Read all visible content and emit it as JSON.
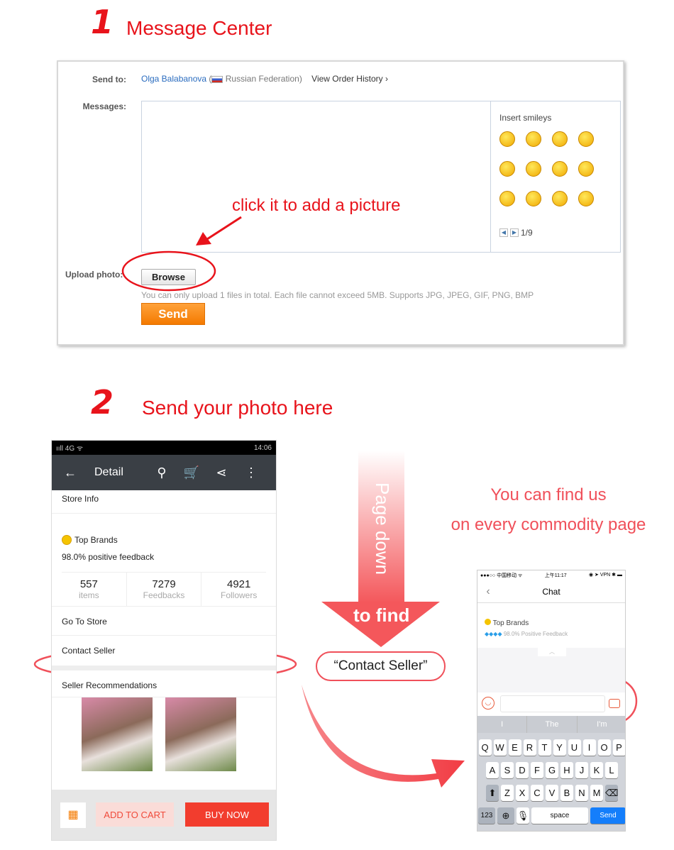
{
  "step1": {
    "number": "1",
    "title": "Message Center"
  },
  "form": {
    "send_to_label": "Send to:",
    "recipient": "Olga Balabanova",
    "country": "Russian Federation)",
    "open_paren": "(",
    "view_history": "View Order History ›",
    "messages_label": "Messages:",
    "insert_smileys": "Insert smileys",
    "smiley_page": "1/9",
    "upload_label": "Upload photo:",
    "browse": "Browse",
    "hint": "You can only upload 1 files in total. Each file cannot exceed 5MB. Supports JPG, JPEG, GIF, PNG, BMP",
    "send": "Send"
  },
  "annotation1": "click it to add a picture",
  "step2": {
    "number": "2",
    "title": "Send your photo here"
  },
  "phone1": {
    "signal": "ııll 4G ᯤ",
    "time": "14:06",
    "title": "Detail",
    "store_info": "Store Info",
    "top_brands": "Top Brands",
    "feedback": "98.0% positive feedback",
    "stats": [
      {
        "value": "557",
        "label": "items"
      },
      {
        "value": "7279",
        "label": "Feedbacks"
      },
      {
        "value": "4921",
        "label": "Followers"
      }
    ],
    "go_to_store": "Go To Store",
    "contact_seller": "Contact Seller",
    "recommendations": "Seller Recommendations",
    "add_to_cart": "ADD TO CART",
    "buy_now": "BUY NOW"
  },
  "arrow": {
    "page_down": "Page down",
    "to_find": "to find",
    "contact_seller": "“Contact Seller”"
  },
  "note": {
    "line1": "You can find us",
    "line2": "on every commodity page"
  },
  "phone2": {
    "carrier": "●●●○○ 中国移动 ᯤ",
    "time": "上午11:17",
    "status_right": "◉ ➤ VPN ✱ ▬",
    "title": "Chat",
    "top_brands": "Top Brands",
    "feedback": "98.0% Positive Feedback",
    "suggestions": [
      "I",
      "The",
      "I'm"
    ],
    "rows": [
      [
        "Q",
        "W",
        "E",
        "R",
        "T",
        "Y",
        "U",
        "I",
        "O",
        "P"
      ],
      [
        "A",
        "S",
        "D",
        "F",
        "G",
        "H",
        "J",
        "K",
        "L"
      ],
      [
        "Z",
        "X",
        "C",
        "V",
        "B",
        "N",
        "M"
      ]
    ],
    "key_123": "123",
    "space": "space",
    "send": "Send"
  },
  "colors": {
    "accent": "#e8131b",
    "annotation": "#f0505a",
    "send_orange": "#f7941d",
    "buy_now": "#f23d2e",
    "ios_send": "#147efb"
  }
}
